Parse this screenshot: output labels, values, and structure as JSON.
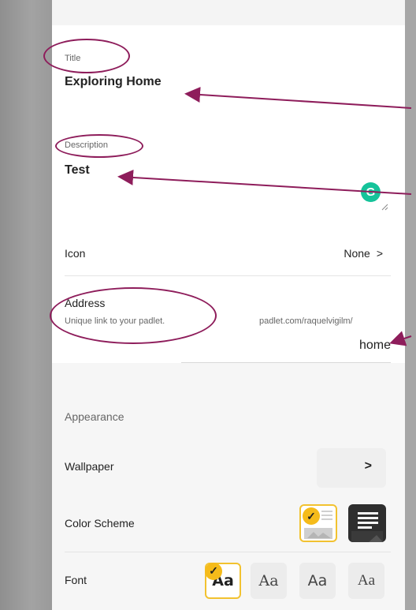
{
  "title_field": {
    "label": "Title",
    "value": "Exploring Home"
  },
  "description_field": {
    "label": "Description",
    "value": "Test"
  },
  "grammarly": {
    "glyph": "G"
  },
  "icon_row": {
    "label": "Icon",
    "value": "None",
    "chevron": ">"
  },
  "address": {
    "label": "Address",
    "sublabel": "Unique link to your padlet.",
    "prefix": "padlet.com/raquelvigilm/",
    "value": "home"
  },
  "appearance": {
    "heading": "Appearance",
    "wallpaper": {
      "label": "Wallpaper",
      "chevron": ">"
    },
    "color_scheme": {
      "label": "Color Scheme",
      "selected": "light"
    },
    "font": {
      "label": "Font",
      "options": [
        "Aa",
        "Aa",
        "Aa",
        "Aa"
      ],
      "selected_index": 0
    }
  },
  "colors": {
    "accent": "#f2c230",
    "annotation": "#8e1d5b",
    "grammarly": "#15c39a"
  }
}
